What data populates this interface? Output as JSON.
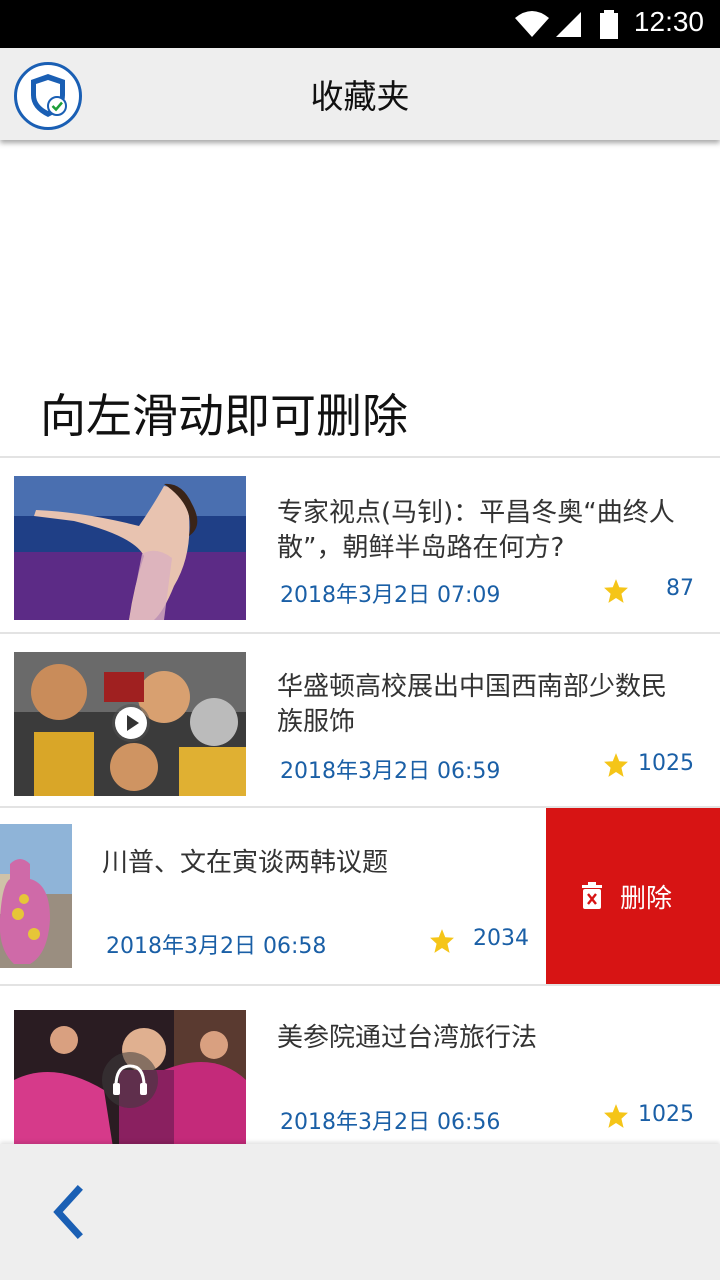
{
  "status_bar": {
    "time": "12:30",
    "icons": [
      "wifi-icon",
      "signal-icon",
      "battery-icon"
    ]
  },
  "app_bar": {
    "title": "收藏夹",
    "logo_icon": "shield-check-icon"
  },
  "hint": "向左滑动即可删除",
  "articles": [
    {
      "title": "专家视点(马钊)：平昌冬奥“曲终人散”，朝鲜半岛路在何方?",
      "date": "2018年3月2日 07:09",
      "count": "87",
      "media": "none"
    },
    {
      "title": "华盛顿高校展出中国西南部少数民族服饰",
      "date": "2018年3月2日 06:59",
      "count": "1025",
      "media": "video"
    },
    {
      "title": "川普、文在寅谈两韩议题",
      "date": "2018年3月2日 06:58",
      "count": "2034",
      "media": "none"
    },
    {
      "title": "美参院通过台湾旅行法",
      "date": "2018年3月2日 06:56",
      "count": "1025",
      "media": "audio"
    }
  ],
  "swipe_action": {
    "label": "删除",
    "icon": "trash-icon"
  },
  "bottom_bar": {
    "back_icon": "chevron-left-icon"
  },
  "colors": {
    "accent": "#1a5fa6",
    "delete": "#d71414",
    "star": "#f5c518"
  }
}
